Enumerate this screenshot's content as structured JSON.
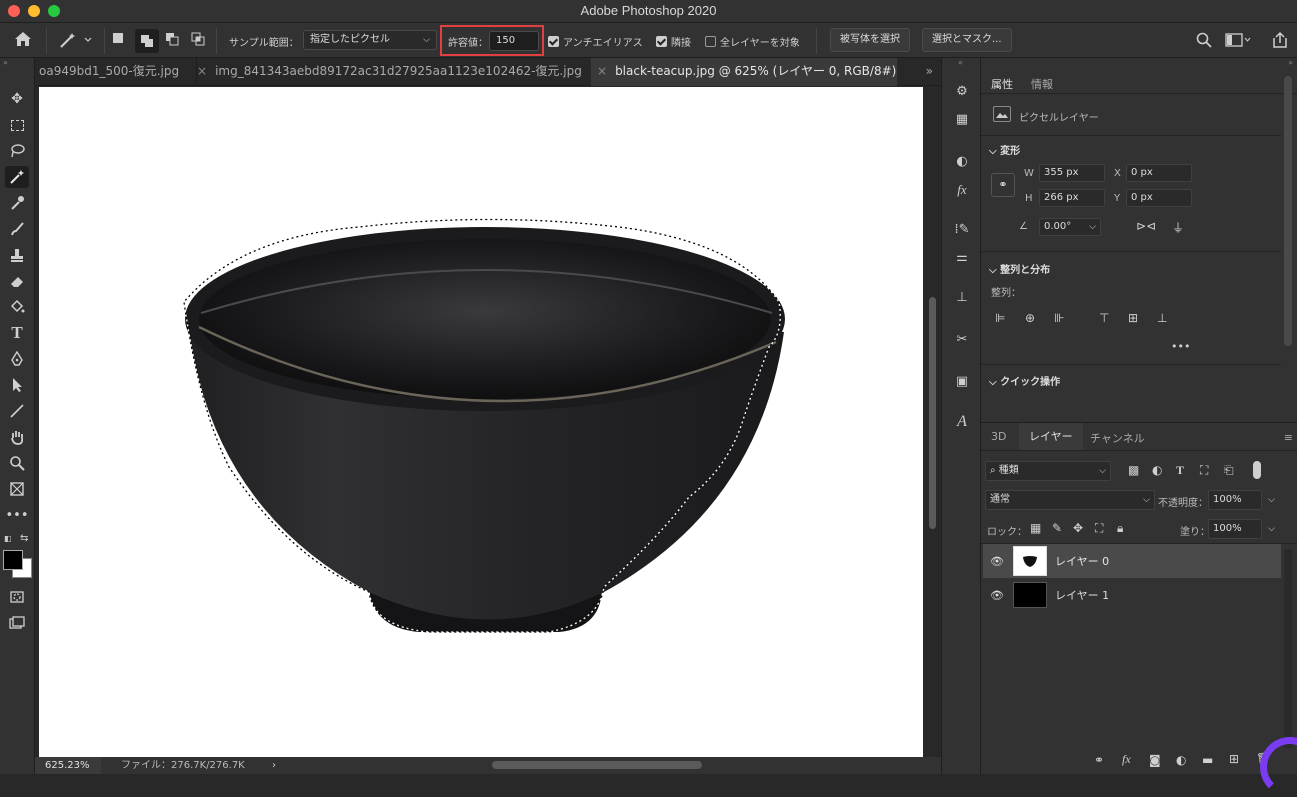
{
  "window": {
    "title": "Adobe Photoshop 2020"
  },
  "options": {
    "sample_label": "サンプル範囲：",
    "sample_value": "指定したピクセル",
    "tolerance_label": "許容値：",
    "tolerance_value": "150",
    "antialias_label": "アンチエイリアス",
    "contiguous_label": "隣接",
    "all_layers_label": "全レイヤーを対象",
    "select_subject_label": "被写体を選択",
    "select_mask_label": "選択とマスク..."
  },
  "tabs": [
    {
      "label": "oa949bd1_500-復元.jpg"
    },
    {
      "label": "img_841343aebd89172ac31d27925aa1123e102462-復元.jpg"
    },
    {
      "label": "black-teacup.jpg @ 625% (レイヤー 0, RGB/8#) *"
    }
  ],
  "status": {
    "zoom": "625.23%",
    "file_info": "ファイル：276.7K/276.7K"
  },
  "properties": {
    "tab_properties": "属性",
    "tab_info": "情報",
    "layer_type": "ピクセルレイヤー",
    "transform_header": "変形",
    "w_label": "W",
    "w_value": "355 px",
    "h_label": "H",
    "h_value": "266 px",
    "x_label": "X",
    "x_value": "0 px",
    "y_label": "Y",
    "y_value": "0 px",
    "angle_value": "0.00°",
    "align_header": "整列と分布",
    "align_label": "整列：",
    "quick_header": "クイック操作"
  },
  "layers_panel": {
    "tab_3d": "3D",
    "tab_layers": "レイヤー",
    "tab_channels": "チャンネル",
    "filter_kind": "種類",
    "blend_mode": "通常",
    "opacity_label": "不透明度：",
    "opacity_value": "100%",
    "lock_label": "ロック：",
    "fill_label": "塗り：",
    "fill_value": "100%",
    "layers": [
      {
        "name": "レイヤー 0"
      },
      {
        "name": "レイヤー 1"
      }
    ]
  },
  "colors": {
    "accent_highlight": "#e04040",
    "bg": "#282828",
    "panel": "#323232"
  }
}
